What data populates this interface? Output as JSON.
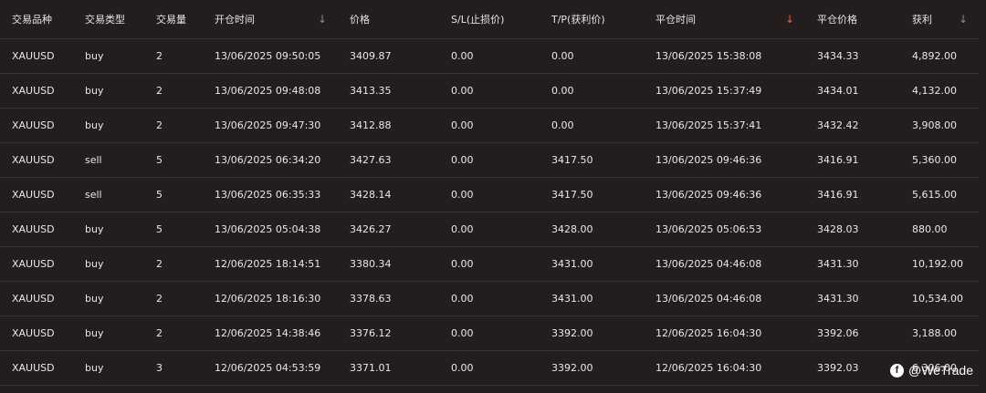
{
  "headers": [
    {
      "label": "交易品种",
      "sort": "none"
    },
    {
      "label": "交易类型",
      "sort": "none"
    },
    {
      "label": "交易量",
      "sort": "none"
    },
    {
      "label": "开仓时间",
      "sort": "desc"
    },
    {
      "label": "价格",
      "sort": "none"
    },
    {
      "label": "S/L(止损价)",
      "sort": "none"
    },
    {
      "label": "T/P(获利价)",
      "sort": "none"
    },
    {
      "label": "平仓时间",
      "sort": "desc-active"
    },
    {
      "label": "平仓价格",
      "sort": "none"
    },
    {
      "label": "获利",
      "sort": "desc"
    }
  ],
  "sort_icon": "arrow-down-icon",
  "sort_active_color": "#d9653b",
  "rows": [
    [
      "XAUUSD",
      "buy",
      "2",
      "13/06/2025 09:50:05",
      "3409.87",
      "0.00",
      "0.00",
      "13/06/2025 15:38:08",
      "3434.33",
      "4,892.00"
    ],
    [
      "XAUUSD",
      "buy",
      "2",
      "13/06/2025 09:48:08",
      "3413.35",
      "0.00",
      "0.00",
      "13/06/2025 15:37:49",
      "3434.01",
      "4,132.00"
    ],
    [
      "XAUUSD",
      "buy",
      "2",
      "13/06/2025 09:47:30",
      "3412.88",
      "0.00",
      "0.00",
      "13/06/2025 15:37:41",
      "3432.42",
      "3,908.00"
    ],
    [
      "XAUUSD",
      "sell",
      "5",
      "13/06/2025 06:34:20",
      "3427.63",
      "0.00",
      "3417.50",
      "13/06/2025 09:46:36",
      "3416.91",
      "5,360.00"
    ],
    [
      "XAUUSD",
      "sell",
      "5",
      "13/06/2025 06:35:33",
      "3428.14",
      "0.00",
      "3417.50",
      "13/06/2025 09:46:36",
      "3416.91",
      "5,615.00"
    ],
    [
      "XAUUSD",
      "buy",
      "5",
      "13/06/2025 05:04:38",
      "3426.27",
      "0.00",
      "3428.00",
      "13/06/2025 05:06:53",
      "3428.03",
      "880.00"
    ],
    [
      "XAUUSD",
      "buy",
      "2",
      "12/06/2025 18:14:51",
      "3380.34",
      "0.00",
      "3431.00",
      "13/06/2025 04:46:08",
      "3431.30",
      "10,192.00"
    ],
    [
      "XAUUSD",
      "buy",
      "2",
      "12/06/2025 18:16:30",
      "3378.63",
      "0.00",
      "3431.00",
      "13/06/2025 04:46:08",
      "3431.30",
      "10,534.00"
    ],
    [
      "XAUUSD",
      "buy",
      "2",
      "12/06/2025 14:38:46",
      "3376.12",
      "0.00",
      "3392.00",
      "12/06/2025 16:04:30",
      "3392.06",
      "3,188.00"
    ],
    [
      "XAUUSD",
      "buy",
      "3",
      "12/06/2025 04:53:59",
      "3371.01",
      "0.00",
      "3392.00",
      "12/06/2025 16:04:30",
      "3392.03",
      "6,306.00"
    ]
  ],
  "watermark": {
    "icon": "facebook-icon",
    "text": "@WeTrade"
  }
}
